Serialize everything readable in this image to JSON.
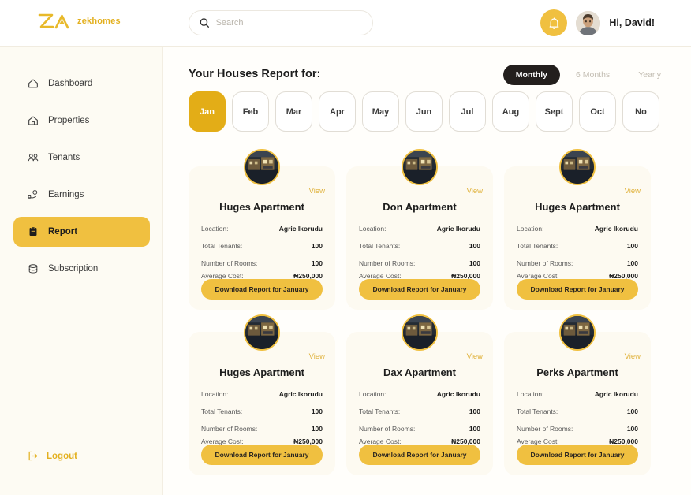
{
  "brand": {
    "name": "zekhomes",
    "logo_icon": "za-monogram-icon",
    "accent": "#e3b01f"
  },
  "header": {
    "search": {
      "placeholder": "Search",
      "value": "",
      "icon": "search-icon"
    },
    "notification_icon": "bell-icon",
    "avatar_icon": "user-avatar",
    "greeting": "Hi, David!"
  },
  "sidebar": {
    "items": [
      {
        "label": "Dashboard",
        "icon": "home-outline-icon",
        "active": false
      },
      {
        "label": "Properties",
        "icon": "house-icon",
        "active": false
      },
      {
        "label": "Tenants",
        "icon": "people-icon",
        "active": false
      },
      {
        "label": "Earnings",
        "icon": "coins-icon",
        "active": false
      },
      {
        "label": "Report",
        "icon": "clipboard-icon",
        "active": true
      },
      {
        "label": "Subscription",
        "icon": "database-icon",
        "active": false
      }
    ],
    "logout": {
      "label": "Logout",
      "icon": "logout-icon"
    }
  },
  "main": {
    "title": "Your Houses Report for:",
    "periods": [
      {
        "label": "Monthly",
        "active": true
      },
      {
        "label": "6 Months",
        "active": false
      },
      {
        "label": "Yearly",
        "active": false
      }
    ],
    "months": [
      {
        "label": "Jan",
        "active": true
      },
      {
        "label": "Feb",
        "active": false
      },
      {
        "label": "Mar",
        "active": false
      },
      {
        "label": "Apr",
        "active": false
      },
      {
        "label": "May",
        "active": false
      },
      {
        "label": "Jun",
        "active": false
      },
      {
        "label": "Jul",
        "active": false
      },
      {
        "label": "Aug",
        "active": false
      },
      {
        "label": "Sept",
        "active": false
      },
      {
        "label": "Oct",
        "active": false
      },
      {
        "label": "No",
        "active": false
      }
    ],
    "row_labels": [
      "Location:",
      "Total Tenants:",
      "Number of Rooms:",
      "Average Cost:"
    ],
    "view_label": "View",
    "download_label": "Download Report for January",
    "cards": [
      {
        "title": "Huges Apartment",
        "location": "Agric Ikorudu",
        "tenants": "100",
        "rooms": "100",
        "cost": "₦250,000"
      },
      {
        "title": "Don Apartment",
        "location": "Agric Ikorudu",
        "tenants": "100",
        "rooms": "100",
        "cost": "₦250,000"
      },
      {
        "title": "Huges Apartment",
        "location": "Agric Ikorudu",
        "tenants": "100",
        "rooms": "100",
        "cost": "₦250,000"
      },
      {
        "title": "Huges Apartment",
        "location": "Agric Ikorudu",
        "tenants": "100",
        "rooms": "100",
        "cost": "₦250,000"
      },
      {
        "title": "Dax Apartment",
        "location": "Agric Ikorudu",
        "tenants": "100",
        "rooms": "100",
        "cost": "₦250,000"
      },
      {
        "title": "Perks Apartment",
        "location": "Agric Ikorudu",
        "tenants": "100",
        "rooms": "100",
        "cost": "₦250,000"
      }
    ]
  },
  "colors": {
    "accent": "#f0c040",
    "accent_dark": "#e3ad17",
    "dark_pill": "#231f1d",
    "card_bg": "#fdfaf1"
  }
}
